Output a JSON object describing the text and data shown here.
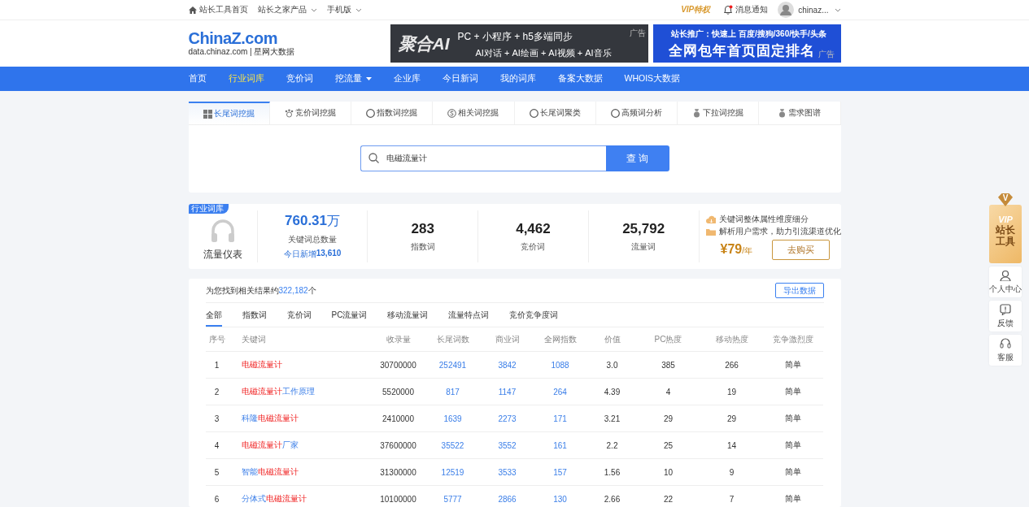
{
  "top_bar": {
    "links": [
      {
        "label": "站长工具首页",
        "kind": "home",
        "dropdown": false
      },
      {
        "label": "站长之家产品",
        "kind": "plain",
        "dropdown": true
      },
      {
        "label": "手机版",
        "kind": "plain",
        "dropdown": true
      }
    ],
    "vip": "VIP特权",
    "notifications": {
      "label": "消息通知",
      "unread": true
    },
    "user": {
      "name": "chinaz...",
      "dropdown": true
    }
  },
  "header": {
    "logo": "ChinaZ.com",
    "logo_sub": "data.chinaz.com | 星网大数据",
    "ads": [
      {
        "kind": "dark",
        "logo": "聚合AI",
        "line1": "PC + 小程序 + h5多端同步",
        "line2": "AI对话 + AI绘画 + AI视频 + AI音乐",
        "tag": "广告"
      },
      {
        "kind": "blue",
        "line1": "站长推广：快速上 百度/搜狗/360/快手/头条",
        "line2": "全网包年首页固定排名",
        "tag": "广告"
      }
    ]
  },
  "nav": [
    {
      "label": "首页",
      "selected": false,
      "dropdown": false
    },
    {
      "label": "行业词库",
      "selected": true,
      "dropdown": false
    },
    {
      "label": "竞价词",
      "selected": false,
      "dropdown": false
    },
    {
      "label": "挖流量",
      "selected": false,
      "dropdown": true
    },
    {
      "label": "企业库",
      "selected": false,
      "dropdown": false
    },
    {
      "label": "今日新词",
      "selected": false,
      "dropdown": false
    },
    {
      "label": "我的词库",
      "selected": false,
      "dropdown": false
    },
    {
      "label": "备案大数据",
      "selected": false,
      "dropdown": false
    },
    {
      "label": "WHOIS大数据",
      "selected": false,
      "dropdown": false
    }
  ],
  "search_tabs": [
    {
      "label": "长尾词挖掘",
      "selected": true
    },
    {
      "label": "竞价词挖掘",
      "selected": false
    },
    {
      "label": "指数词挖掘",
      "selected": false
    },
    {
      "label": "相关词挖掘",
      "selected": false
    },
    {
      "label": "长尾词聚类",
      "selected": false
    },
    {
      "label": "高频词分析",
      "selected": false
    },
    {
      "label": "下拉词挖掘",
      "selected": false
    },
    {
      "label": "需求图谱",
      "selected": false
    }
  ],
  "search": {
    "value": "电磁流量计",
    "button": "查 询"
  },
  "stats": {
    "badge": "行业词库",
    "title": "流量仪表",
    "total": {
      "value": "760.31",
      "unit": "万",
      "label": "关键词总数量",
      "today_label": "今日新增",
      "today_value": "13,610"
    },
    "metrics": [
      {
        "value": "283",
        "label": "指数词"
      },
      {
        "value": "4,462",
        "label": "竞价词"
      },
      {
        "value": "25,792",
        "label": "流量词"
      }
    ],
    "promo": {
      "features": [
        "关键词整体属性维度细分",
        "解析用户需求，助力引流渠道优化"
      ],
      "price": "¥79",
      "period": "/年",
      "button": "去购买"
    }
  },
  "results": {
    "summary_prefix": "为您找到相关结果约",
    "count": "322,182",
    "summary_suffix": "个",
    "export": "导出数据",
    "filters": [
      {
        "label": "全部",
        "selected": true
      },
      {
        "label": "指数词",
        "selected": false
      },
      {
        "label": "竞价词",
        "selected": false
      },
      {
        "label": "PC流量词",
        "selected": false
      },
      {
        "label": "移动流量词",
        "selected": false
      },
      {
        "label": "流量特点词",
        "selected": false
      },
      {
        "label": "竞价竞争度词",
        "selected": false
      }
    ],
    "table": {
      "columns": [
        "序号",
        "关键词",
        "收录量",
        "长尾词数",
        "商业词",
        "全网指数",
        "价值",
        "PC热度",
        "移动热度",
        "竞争激烈度"
      ],
      "rows": [
        {
          "cells": [
            "1",
            {
              "parts": [
                {
                  "text": "电磁流量计",
                  "match": true
                }
              ]
            },
            "30700000",
            "252491",
            "3842",
            "1088",
            "3.0",
            "385",
            "266",
            "简单"
          ]
        },
        {
          "cells": [
            "2",
            {
              "parts": [
                {
                  "text": "电磁流量计",
                  "match": true
                },
                {
                  "text": "工作原理",
                  "match": false
                }
              ]
            },
            "5520000",
            "817",
            "1147",
            "264",
            "4.39",
            "4",
            "19",
            "简单"
          ]
        },
        {
          "cells": [
            "3",
            {
              "parts": [
                {
                  "text": "科隆",
                  "match": false
                },
                {
                  "text": "电磁流量计",
                  "match": true
                }
              ]
            },
            "2410000",
            "1639",
            "2273",
            "171",
            "3.21",
            "29",
            "29",
            "简单"
          ]
        },
        {
          "cells": [
            "4",
            {
              "parts": [
                {
                  "text": "电磁流量计",
                  "match": true
                },
                {
                  "text": "厂家",
                  "match": false
                }
              ]
            },
            "37600000",
            "35522",
            "3552",
            "161",
            "2.2",
            "25",
            "14",
            "简单"
          ]
        },
        {
          "cells": [
            "5",
            {
              "parts": [
                {
                  "text": "智能",
                  "match": false
                },
                {
                  "text": "电磁流量计",
                  "match": true
                }
              ]
            },
            "31300000",
            "12519",
            "3533",
            "157",
            "1.56",
            "10",
            "9",
            "简单"
          ]
        },
        {
          "cells": [
            "6",
            {
              "parts": [
                {
                  "text": "分体式",
                  "match": false
                },
                {
                  "text": "电磁流量计",
                  "match": true
                }
              ]
            },
            "10100000",
            "5777",
            "2866",
            "130",
            "2.66",
            "22",
            "7",
            "简单"
          ]
        }
      ]
    }
  },
  "side_tools": {
    "vip": {
      "mark": "V",
      "title": "VIP",
      "lines": [
        "站长",
        "工具"
      ]
    },
    "items": [
      {
        "label": "个人中心",
        "kind": "user"
      },
      {
        "label": "反馈",
        "kind": "feedback"
      },
      {
        "label": "客服",
        "kind": "service"
      }
    ]
  }
}
